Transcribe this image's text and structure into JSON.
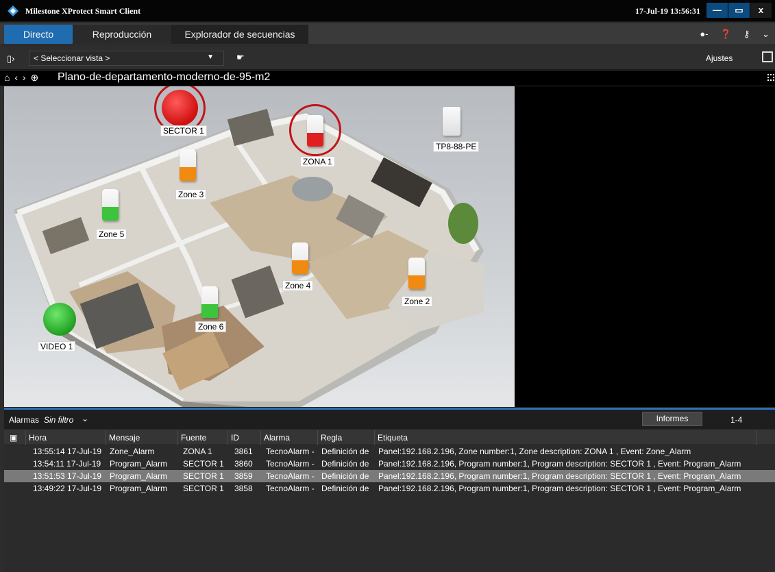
{
  "window": {
    "title": "Milestone XProtect Smart Client",
    "clock": "17-Jul-19 13:56:31",
    "min_glyph": "—",
    "max_glyph": "▭",
    "close_glyph": "x"
  },
  "tabs": [
    {
      "label": "Directo",
      "active": true
    },
    {
      "label": "Reproducción",
      "active": false
    },
    {
      "label": "Explorador de secuencias",
      "active": false
    }
  ],
  "toolbar": {
    "view_select": "< Seleccionar vista >",
    "settings_label": "Ajustes"
  },
  "breadcrumb": {
    "map_title": "Plano-de-departamento-moderno-de-95-m2"
  },
  "map": {
    "labels": {
      "sector1": "SECTOR 1",
      "zona1": "ZONA 1",
      "tp8": "TP8-88-PE",
      "zone3": "Zone 3",
      "zone5": "Zone 5",
      "zone4": "Zone 4",
      "zone2": "Zone 2",
      "zone6": "Zone 6",
      "video1": "VIDEO 1"
    },
    "status_colors": {
      "alarm_red": "#e02020",
      "ok_green": "#3cc43c",
      "warning_orange": "#f08a10"
    }
  },
  "alarms": {
    "title": "Alarmas",
    "filter": "Sin filtro",
    "reports_label": "Informes",
    "count": "1-4",
    "columns": [
      "Hora",
      "Mensaje",
      "Fuente",
      "ID",
      "Alarma",
      "Regla",
      "Etiqueta"
    ],
    "rows": [
      {
        "hora": "13:55:14 17-Jul-19",
        "mensaje": "Zone_Alarm",
        "fuente": "ZONA 1",
        "id": "3861",
        "alarma": "TecnoAlarm -",
        "regla": "Definición de",
        "etiqueta": "Panel:192.168.2.196, Zone number:1, Zone description: ZONA 1 , Event: Zone_Alarm"
      },
      {
        "hora": "13:54:11 17-Jul-19",
        "mensaje": "Program_Alarm",
        "fuente": "SECTOR 1",
        "id": "3860",
        "alarma": "TecnoAlarm -",
        "regla": "Definición de",
        "etiqueta": "Panel:192.168.2.196, Program number:1, Program description: SECTOR 1 , Event: Program_Alarm"
      },
      {
        "hora": "13:51:53 17-Jul-19",
        "mensaje": "Program_Alarm",
        "fuente": "SECTOR 1",
        "id": "3859",
        "alarma": "TecnoAlarm -",
        "regla": "Definición de",
        "etiqueta": "Panel:192.168.2.196, Program number:1, Program description: SECTOR 1 , Event: Program_Alarm"
      },
      {
        "hora": "13:49:22 17-Jul-19",
        "mensaje": "Program_Alarm",
        "fuente": "SECTOR 1",
        "id": "3858",
        "alarma": "TecnoAlarm -",
        "regla": "Definición de",
        "etiqueta": "Panel:192.168.2.196, Program number:1, Program description: SECTOR 1 , Event: Program_Alarm"
      }
    ],
    "selected_row": 2
  }
}
